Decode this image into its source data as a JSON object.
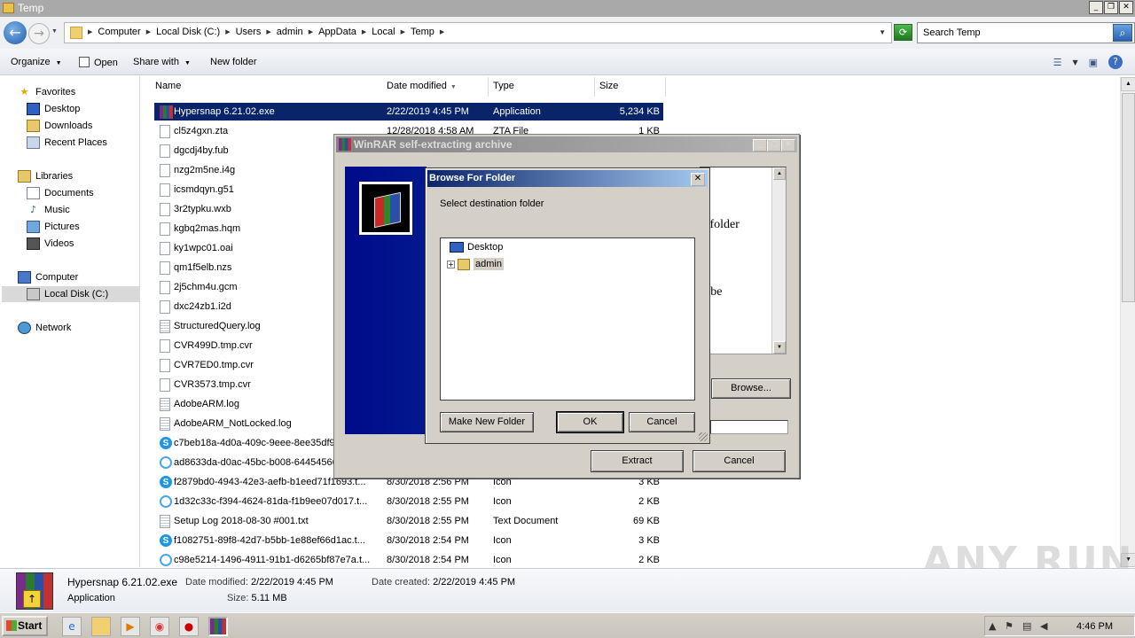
{
  "window": {
    "title": "Temp"
  },
  "address": {
    "crumbs": [
      "Computer",
      "Local Disk (C:)",
      "Users",
      "admin",
      "AppData",
      "Local",
      "Temp"
    ],
    "search_placeholder": "Search Temp"
  },
  "toolbar": {
    "organize": "Organize",
    "open": "Open",
    "share_with": "Share with",
    "new_folder": "New folder"
  },
  "nav": {
    "favorites": "Favorites",
    "desktop": "Desktop",
    "downloads": "Downloads",
    "recent_places": "Recent Places",
    "libraries": "Libraries",
    "documents": "Documents",
    "music": "Music",
    "pictures": "Pictures",
    "videos": "Videos",
    "computer": "Computer",
    "local_disk": "Local Disk (C:)",
    "network": "Network"
  },
  "columns": {
    "name": "Name",
    "date_modified": "Date modified",
    "type": "Type",
    "size": "Size"
  },
  "files": [
    {
      "name": "Hypersnap 6.21.02.exe",
      "date": "2/22/2019 4:45 PM",
      "type": "Application",
      "size": "5,234 KB"
    },
    {
      "name": "cl5z4gxn.zta",
      "date": "12/28/2018 4:58 AM",
      "type": "ZTA File",
      "size": "1 KB"
    },
    {
      "name": "dgcdj4by.fub",
      "date": "",
      "type": "",
      "size": ""
    },
    {
      "name": "nzg2m5ne.i4g",
      "date": "",
      "type": "",
      "size": ""
    },
    {
      "name": "icsmdqyn.g51",
      "date": "",
      "type": "",
      "size": ""
    },
    {
      "name": "3r2typku.wxb",
      "date": "",
      "type": "",
      "size": ""
    },
    {
      "name": "kgbq2mas.hqm",
      "date": "",
      "type": "",
      "size": ""
    },
    {
      "name": "ky1wpc01.oai",
      "date": "",
      "type": "",
      "size": ""
    },
    {
      "name": "qm1f5elb.nzs",
      "date": "",
      "type": "",
      "size": ""
    },
    {
      "name": "2j5chm4u.gcm",
      "date": "",
      "type": "",
      "size": ""
    },
    {
      "name": "dxc24zb1.i2d",
      "date": "",
      "type": "",
      "size": ""
    },
    {
      "name": "StructuredQuery.log",
      "date": "",
      "type": "",
      "size": ""
    },
    {
      "name": "CVR499D.tmp.cvr",
      "date": "",
      "type": "",
      "size": ""
    },
    {
      "name": "CVR7ED0.tmp.cvr",
      "date": "",
      "type": "",
      "size": ""
    },
    {
      "name": "CVR3573.tmp.cvr",
      "date": "",
      "type": "",
      "size": ""
    },
    {
      "name": "AdobeARM.log",
      "date": "",
      "type": "",
      "size": ""
    },
    {
      "name": "AdobeARM_NotLocked.log",
      "date": "",
      "type": "",
      "size": ""
    },
    {
      "name": "c7beb18a-4d0a-409c-9eee-8ee35df9",
      "date": "",
      "type": "",
      "size": ""
    },
    {
      "name": "ad8633da-d0ac-45bc-b008-64454566",
      "date": "",
      "type": "",
      "size": ""
    },
    {
      "name": "f2879bd0-4943-42e3-aefb-b1eed71f1693.t...",
      "date": "8/30/2018 2:56 PM",
      "type": "Icon",
      "size": "3 KB"
    },
    {
      "name": "1d32c33c-f394-4624-81da-f1b9ee07d017.t...",
      "date": "8/30/2018 2:55 PM",
      "type": "Icon",
      "size": "2 KB"
    },
    {
      "name": "Setup Log 2018-08-30 #001.txt",
      "date": "8/30/2018 2:55 PM",
      "type": "Text Document",
      "size": "69 KB"
    },
    {
      "name": "f1082751-89f8-42d7-b5bb-1e88ef66d1ac.t...",
      "date": "8/30/2018 2:54 PM",
      "type": "Icon",
      "size": "3 KB"
    },
    {
      "name": "c98e5214-1496-4911-91b1-d6265bf87e7a.t...",
      "date": "8/30/2018 2:54 PM",
      "type": "Icon",
      "size": "2 KB"
    }
  ],
  "details": {
    "name": "Hypersnap 6.21.02.exe",
    "kind": "Application",
    "date_modified_label": "Date modified:",
    "date_modified": "2/22/2019 4:45 PM",
    "date_created_label": "Date created:",
    "date_created": "2/22/2019 4:45 PM",
    "size_label": "Size:",
    "size": "5.11 MB"
  },
  "winrar": {
    "title": "WinRAR self-extracting archive",
    "text_line1": "n folder",
    "text_line2": "l",
    "text_line3": "ll be",
    "browse": "Browse...",
    "extract": "Extract",
    "cancel": "Cancel"
  },
  "browse_dialog": {
    "title": "Browse For Folder",
    "prompt": "Select destination folder",
    "tree_desktop": "Desktop",
    "tree_admin": "admin",
    "expander": "+",
    "make_new_folder": "Make New Folder",
    "ok": "OK",
    "cancel": "Cancel"
  },
  "taskbar": {
    "start": "Start",
    "clock": "4:46 PM"
  },
  "watermark": "ANY RUN"
}
